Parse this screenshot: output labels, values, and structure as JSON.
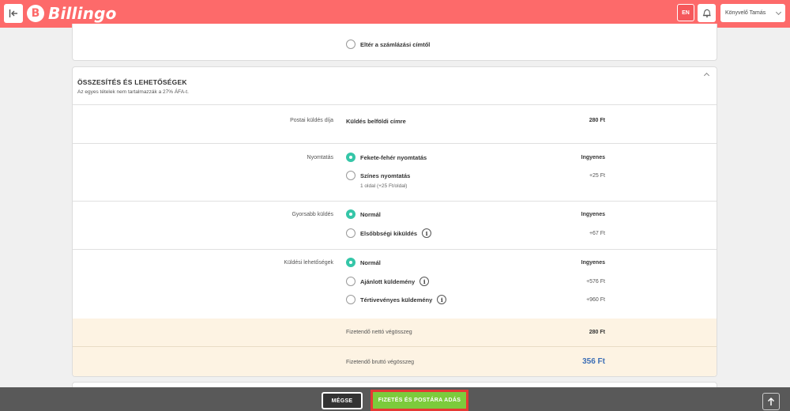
{
  "header": {
    "brand": "Billingo",
    "brand_initial": "B",
    "lang": "EN",
    "user": "Könyvelő Tamás"
  },
  "address_option": {
    "label": "Eltér a számlázási címtől"
  },
  "summary_section": {
    "title": "ÖSSZESÍTÉS ÉS LEHETŐSÉGEK",
    "subtitle": "Az egyes tételek nem tartalmazzák a 27% ÁFA-t.",
    "postal": {
      "label": "Postai küldés díja",
      "value": "Küldés belföldi címre",
      "price": "280 Ft"
    },
    "printing": {
      "label": "Nyomtatás",
      "options": [
        {
          "label": "Fekete-fehér nyomtatás",
          "price": "Ingyenes",
          "selected": true
        },
        {
          "label": "Színes nyomtatás",
          "price": "+25 Ft",
          "selected": false,
          "sub": "1 oldal (+25 Ft/oldal)"
        }
      ]
    },
    "speed": {
      "label": "Gyorsabb küldés",
      "options": [
        {
          "label": "Normál",
          "price": "Ingyenes",
          "selected": true
        },
        {
          "label": "Elsőbbségi kiküldés",
          "price": "+67 Ft",
          "selected": false
        }
      ]
    },
    "delivery": {
      "label": "Küldési lehetőségek",
      "options": [
        {
          "label": "Normál",
          "price": "Ingyenes",
          "selected": true
        },
        {
          "label": "Ajánlott küldemény",
          "price": "+576 Ft",
          "selected": false
        },
        {
          "label": "Tértivevényes küldemény",
          "price": "+960 Ft",
          "selected": false
        }
      ]
    },
    "net_total": {
      "label": "Fizetendő nettó végösszeg",
      "value": "280 Ft"
    },
    "gross_total": {
      "label": "Fizetendő bruttó végösszeg",
      "value": "356 Ft"
    }
  },
  "footer": {
    "cancel_label": "MÉGSE",
    "pay_label": "FIZETÉS ÉS POSTÁRA ADÁS"
  },
  "colors": {
    "brand": "#fd6a6a",
    "radio_selected": "#35c6a8",
    "pay_button": "#7ccb3c",
    "highlight_border": "#e53935",
    "total_text": "#3d6fb6"
  }
}
